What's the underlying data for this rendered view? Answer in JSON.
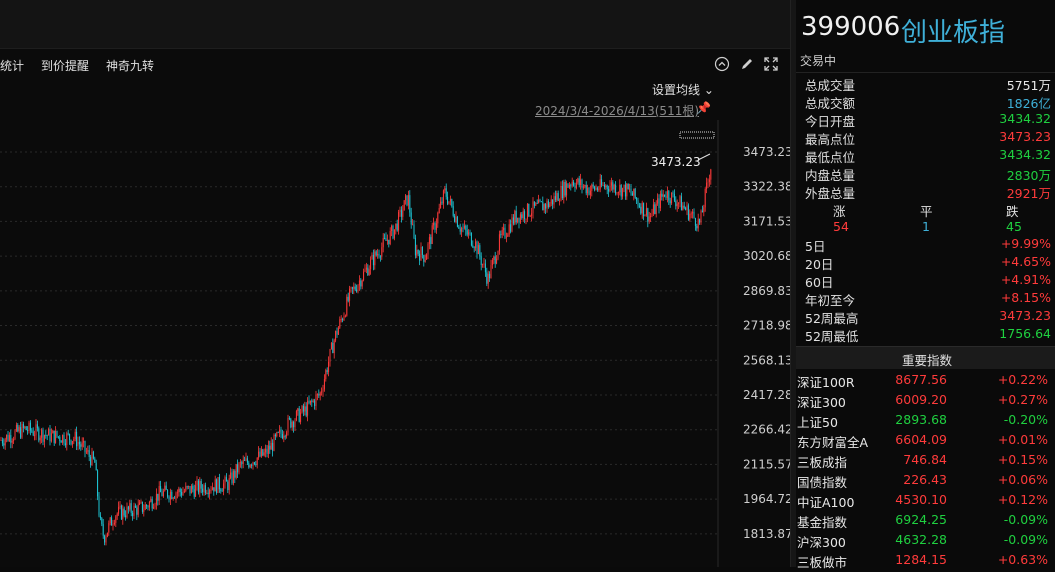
{
  "toolbar": {
    "items": [
      "统计",
      "到价提醒",
      "神奇九转"
    ],
    "icons": [
      "chevron-up-circle-icon",
      "pen-icon",
      "expand-icon"
    ]
  },
  "chart": {
    "ma_setting": "设置均线",
    "date_range": "2024/3/4-2026/4/13(511根)",
    "high_marker": "3473.23"
  },
  "chart_data": {
    "type": "candlestick",
    "y_ticks": [
      "3473.23",
      "3322.38",
      "3171.53",
      "3020.68",
      "2869.83",
      "2718.98",
      "2568.13",
      "2417.28",
      "2266.42",
      "2115.57",
      "1964.72",
      "1813.87"
    ],
    "ylim": [
      1756.64,
      3473.23
    ],
    "grid": true,
    "colors": {
      "up": "#ff3b3b",
      "down": "#1ec8d8"
    },
    "close_path": [
      [
        0,
        2220
      ],
      [
        25,
        2270
      ],
      [
        50,
        2240
      ],
      [
        75,
        2230
      ],
      [
        95,
        2120
      ],
      [
        100,
        1860
      ],
      [
        104,
        1800
      ],
      [
        115,
        1900
      ],
      [
        145,
        1930
      ],
      [
        160,
        1990
      ],
      [
        185,
        2000
      ],
      [
        205,
        2020
      ],
      [
        228,
        2030
      ],
      [
        240,
        2110
      ],
      [
        265,
        2160
      ],
      [
        290,
        2300
      ],
      [
        305,
        2350
      ],
      [
        320,
        2420
      ],
      [
        335,
        2670
      ],
      [
        350,
        2850
      ],
      [
        375,
        3020
      ],
      [
        395,
        3140
      ],
      [
        408,
        3280
      ],
      [
        415,
        3050
      ],
      [
        425,
        3020
      ],
      [
        445,
        3300
      ],
      [
        460,
        3150
      ],
      [
        475,
        3080
      ],
      [
        488,
        2920
      ],
      [
        500,
        3090
      ],
      [
        515,
        3190
      ],
      [
        530,
        3220
      ],
      [
        550,
        3250
      ],
      [
        572,
        3350
      ],
      [
        590,
        3310
      ],
      [
        610,
        3330
      ],
      [
        630,
        3300
      ],
      [
        650,
        3190
      ],
      [
        665,
        3300
      ],
      [
        680,
        3250
      ],
      [
        700,
        3160
      ],
      [
        712,
        3440
      ]
    ]
  },
  "quote": {
    "code": "399006",
    "name": "创业板指",
    "status": "交易中",
    "stats": [
      {
        "label": "总成交量",
        "value": "5751万",
        "color": "white"
      },
      {
        "label": "总成交额",
        "value": "1826亿",
        "color": "blue"
      },
      {
        "label": "今日开盘",
        "value": "3434.32",
        "color": "green"
      },
      {
        "label": "最高点位",
        "value": "3473.23",
        "color": "red"
      },
      {
        "label": "最低点位",
        "value": "3434.32",
        "color": "green"
      },
      {
        "label": "内盘总量",
        "value": "2830万",
        "color": "green"
      },
      {
        "label": "外盘总量",
        "value": "2921万",
        "color": "red"
      }
    ],
    "updown": {
      "labels": [
        "涨",
        "平",
        "跌"
      ],
      "values": [
        "54",
        "1",
        "45"
      ]
    },
    "periods": [
      {
        "label": "5日",
        "value": "+9.99%"
      },
      {
        "label": "20日",
        "value": "+4.65%"
      },
      {
        "label": "60日",
        "value": "+4.91%"
      },
      {
        "label": "年初至今",
        "value": "+8.15%"
      },
      {
        "label": "52周最高",
        "value": "3473.23"
      },
      {
        "label": "52周最低",
        "value": "1756.64"
      }
    ]
  },
  "indices": {
    "title": "重要指数",
    "rows": [
      {
        "name": "深证100R",
        "price": "8677.56",
        "change": "+0.22%",
        "color": "red"
      },
      {
        "name": "深证300",
        "price": "6009.20",
        "change": "+0.27%",
        "color": "red"
      },
      {
        "name": "上证50",
        "price": "2893.68",
        "change": "-0.20%",
        "color": "green"
      },
      {
        "name": "东方财富全A",
        "price": "6604.09",
        "change": "+0.01%",
        "color": "red"
      },
      {
        "name": "三板成指",
        "price": "746.84",
        "change": "+0.15%",
        "color": "red"
      },
      {
        "name": "国债指数",
        "price": "226.43",
        "change": "+0.06%",
        "color": "red"
      },
      {
        "name": "中证A100",
        "price": "4530.10",
        "change": "+0.12%",
        "color": "red"
      },
      {
        "name": "基金指数",
        "price": "6924.25",
        "change": "-0.09%",
        "color": "green"
      },
      {
        "name": "沪深300",
        "price": "4632.28",
        "change": "-0.09%",
        "color": "green"
      },
      {
        "name": "三板做市",
        "price": "1284.15",
        "change": "+0.63%",
        "color": "red"
      }
    ]
  }
}
